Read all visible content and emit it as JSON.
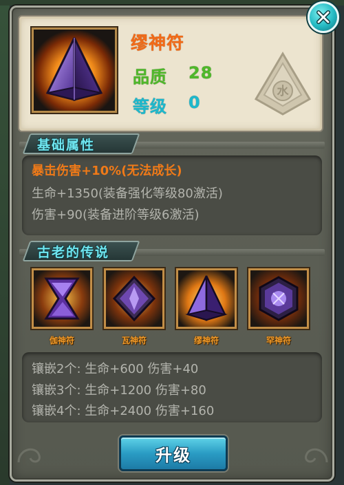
{
  "item": {
    "name": "缪神符",
    "quality_label": "品质",
    "quality_value": "28",
    "level_label": "等级",
    "level_value": "0",
    "emblem_text": "水"
  },
  "basic_attributes": {
    "title": "基础属性",
    "lines": [
      "暴击伤害+10%(无法成长)",
      "生命+1350(装备强化等级80激活)",
      "伤害+90(装备进阶等级6激活)"
    ]
  },
  "legend": {
    "title": "古老的传说",
    "items": [
      {
        "name": "伽神符"
      },
      {
        "name": "瓦神符"
      },
      {
        "name": "缪神符"
      },
      {
        "name": "罕神符"
      }
    ],
    "set_bonuses": [
      "镶嵌2个: 生命+600 伤害+40",
      "镶嵌3个: 生命+1200 伤害+80",
      "镶嵌4个: 生命+2400 伤害+160"
    ]
  },
  "buttons": {
    "upgrade_label": "升级"
  },
  "icons": {
    "close": "close-icon",
    "item": "crystal-pyramid-icon",
    "emblem": "water-element-emblem-icon"
  },
  "colors": {
    "item_name": "#f26a17",
    "quality": "#4fb82a",
    "level": "#1db8cc",
    "section_title": "#6fe6f0",
    "highlight_attr": "#f07a18",
    "normal_attr": "#b3b4ad",
    "rune_label": "#f09a2a"
  }
}
